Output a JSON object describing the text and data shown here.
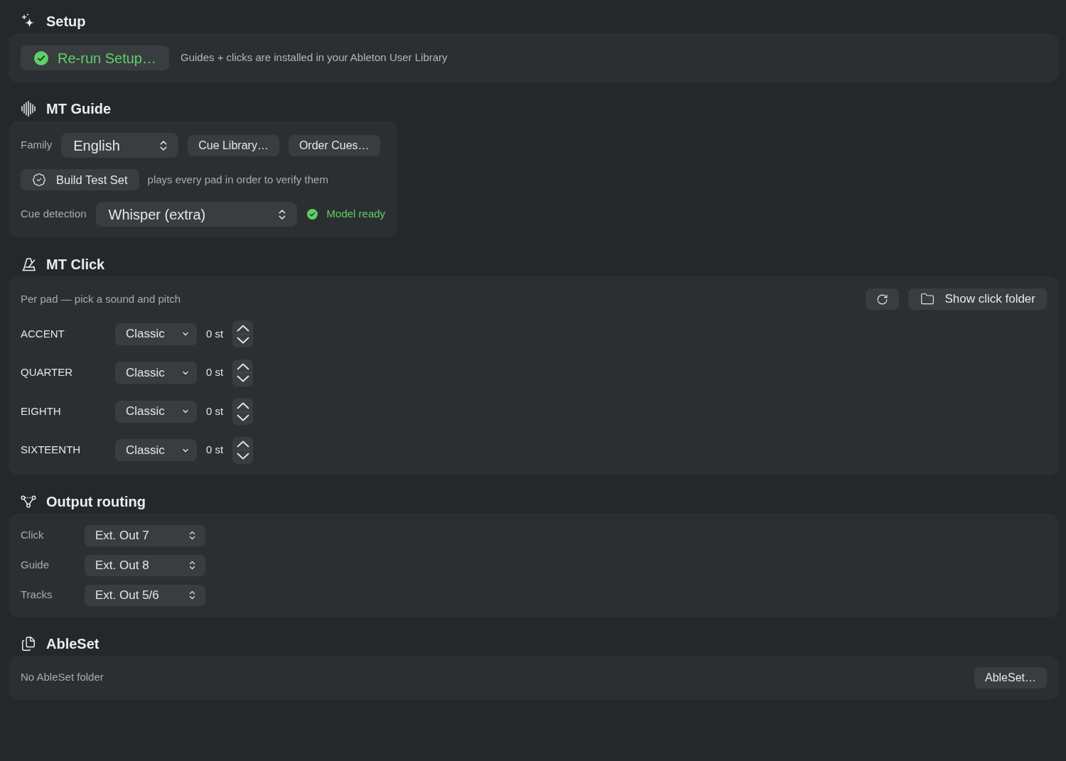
{
  "setup": {
    "title": "Setup",
    "rerun_button": {
      "label": "Re-run Setup…",
      "done": true
    },
    "note": "Guides + clicks are installed in your Ableton User Library"
  },
  "mt_guide": {
    "title": "MT Guide",
    "family": {
      "label": "Family",
      "value": "English"
    },
    "buttons": [
      "Cue Library…",
      "Order Cues…"
    ],
    "test_set": {
      "button": "Build Test Set",
      "note": "plays every pad in order to verify them"
    },
    "cue_detection": {
      "label": "Cue detection",
      "value": "Whisper (extra)",
      "status": {
        "text": "Model ready",
        "ready": true
      }
    }
  },
  "mt_click": {
    "title": "MT Click",
    "hint": "Per pad — pick a sound and pitch",
    "show_folder_button": "Show click folder",
    "pads": [
      {
        "name": "ACCENT",
        "sound": "Classic",
        "pitch": "0 st"
      },
      {
        "name": "QUARTER",
        "sound": "Classic",
        "pitch": "0 st"
      },
      {
        "name": "EIGHTH",
        "sound": "Classic",
        "pitch": "0 st"
      },
      {
        "name": "SIXTEENTH",
        "sound": "Classic",
        "pitch": "0 st"
      }
    ]
  },
  "output_routing": {
    "title": "Output routing",
    "routes": [
      {
        "label": "Click",
        "value": "Ext. Out 7"
      },
      {
        "label": "Guide",
        "value": "Ext. Out 8"
      },
      {
        "label": "Tracks",
        "value": "Ext. Out 5/6"
      }
    ]
  },
  "ableset": {
    "title": "AbleSet",
    "status": "No AbleSet folder",
    "button": "AbleSet…"
  }
}
